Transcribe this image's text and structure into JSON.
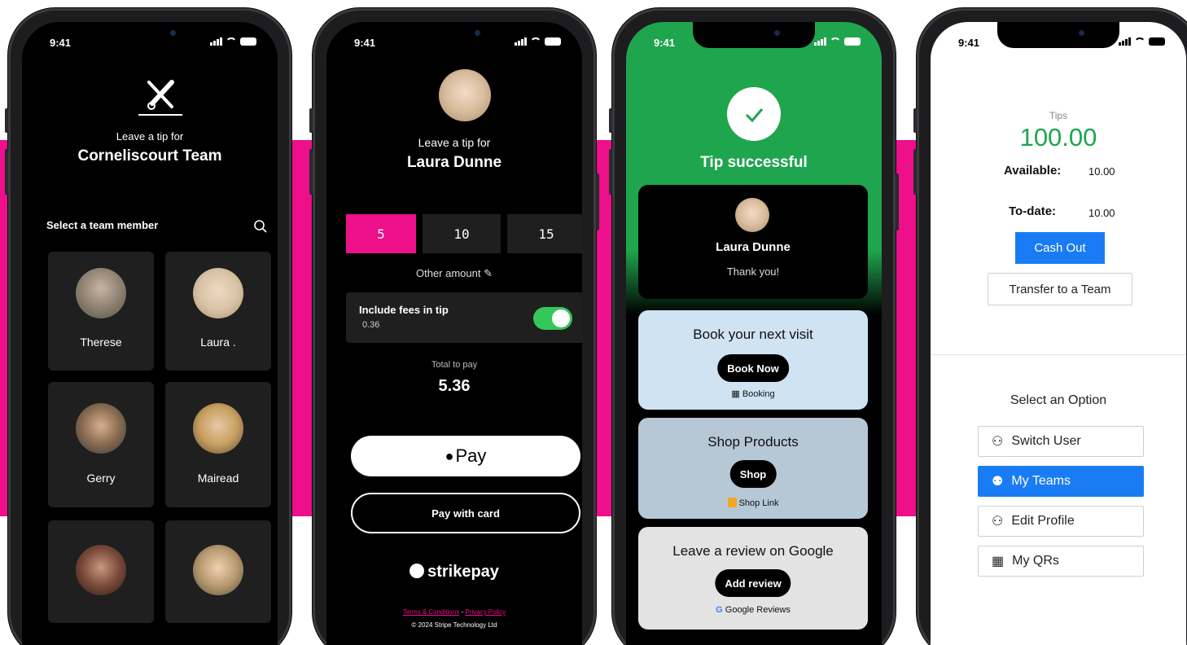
{
  "status_time": "9:41",
  "phone1": {
    "intro": "Leave a tip for",
    "team_name": "Corneliscourt Team",
    "section_label": "Select a team member",
    "members": [
      {
        "name": "Therese",
        "color": "#8a7c6e"
      },
      {
        "name": "Laura .",
        "color": "#d9c4a8"
      },
      {
        "name": "Gerry",
        "color": "#6b5a4a"
      },
      {
        "name": "Mairead",
        "color": "#c8a060"
      },
      {
        "name": "",
        "color": "#5a3a2e"
      },
      {
        "name": "",
        "color": "#b89a70"
      }
    ]
  },
  "phone2": {
    "intro": "Leave a tip for",
    "person_name": "Laura Dunne",
    "amounts": [
      "5",
      "10",
      "15"
    ],
    "other_amount": "Other amount",
    "fees_label": "Include fees in tip",
    "fees_value": "0.36",
    "total_label": "Total to pay",
    "total_value": "5.36",
    "apple_pay": "Pay",
    "pay_card": "Pay with card",
    "brand": "strikepay",
    "terms": "Terms & Conditions",
    "separator": "-",
    "privacy": "Privacy Policy",
    "copyright": "© 2024 Stripe Technology Ltd",
    "accent": "#ee0f8a"
  },
  "phone3": {
    "success": "Tip successful",
    "person_name": "Laura Dunne",
    "thanks": "Thank you!",
    "cards": [
      {
        "title": "Book your next visit",
        "button": "Book Now",
        "link": "Booking",
        "color": "#cfe3f2"
      },
      {
        "title": "Shop Products",
        "button": "Shop",
        "link": "Shop Link",
        "color": "#b6c7d6"
      },
      {
        "title": "Leave a review on Google",
        "button": "Add review",
        "link": "Google Reviews",
        "color": "#e3e3e3"
      }
    ]
  },
  "phone4": {
    "tips_label": "Tips",
    "tips_value": "100.00",
    "available_label": "Available:",
    "available_value": "10.00",
    "todate_label": "To-date:",
    "todate_value": "10.00",
    "cash_out": "Cash Out",
    "transfer": "Transfer to a Team",
    "select_option": "Select an Option",
    "options": [
      {
        "label": "Switch User",
        "icon": "user-icon"
      },
      {
        "label": "My Teams",
        "icon": "team-icon"
      },
      {
        "label": "Edit Profile",
        "icon": "user-icon"
      },
      {
        "label": "My QRs",
        "icon": "qr-icon"
      }
    ],
    "accent": "#1a7cf5",
    "tips_color": "#1fa54e"
  }
}
